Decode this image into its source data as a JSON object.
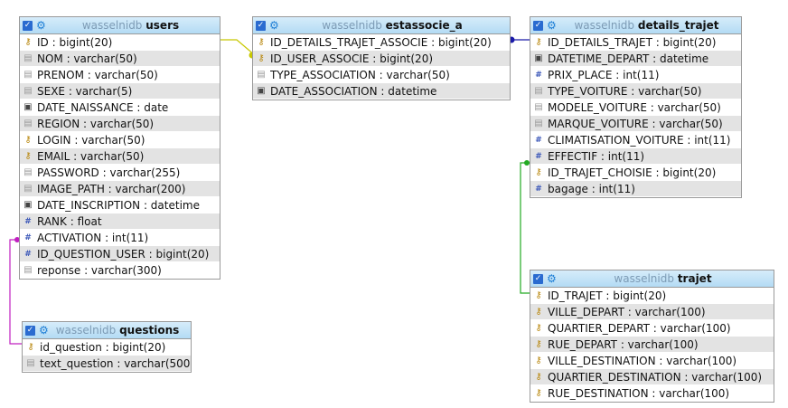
{
  "tables": [
    {
      "id": "users",
      "db": "wasselnidb",
      "name": "users",
      "rows": [
        {
          "text": "ID : bigint(20)",
          "icon": "key-icon"
        },
        {
          "text": "NOM : varchar(50)",
          "icon": "text-icon"
        },
        {
          "text": "PRENOM : varchar(50)",
          "icon": "text-icon"
        },
        {
          "text": "SEXE : varchar(5)",
          "icon": "text-icon"
        },
        {
          "text": "DATE_NAISSANCE : date",
          "icon": "date-icon"
        },
        {
          "text": "REGION : varchar(50)",
          "icon": "text-icon"
        },
        {
          "text": "LOGIN : varchar(50)",
          "icon": "key-icon"
        },
        {
          "text": "EMAIL : varchar(50)",
          "icon": "key-icon"
        },
        {
          "text": "PASSWORD : varchar(255)",
          "icon": "text-icon"
        },
        {
          "text": "IMAGE_PATH : varchar(200)",
          "icon": "text-icon"
        },
        {
          "text": "DATE_INSCRIPTION : datetime",
          "icon": "date-icon"
        },
        {
          "text": "RANK : float",
          "icon": "number-icon"
        },
        {
          "text": "ACTIVATION : int(11)",
          "icon": "number-icon"
        },
        {
          "text": "ID_QUESTION_USER : bigint(20)",
          "icon": "number-icon"
        },
        {
          "text": "reponse : varchar(300)",
          "icon": "text-icon"
        }
      ]
    },
    {
      "id": "questions",
      "db": "wasselnidb",
      "name": "questions",
      "rows": [
        {
          "text": "id_question : bigint(20)",
          "icon": "key-icon"
        },
        {
          "text": "text_question : varchar(500)",
          "icon": "text-icon"
        }
      ]
    },
    {
      "id": "estassocie_a",
      "db": "wasselnidb",
      "name": "estassocie_a",
      "rows": [
        {
          "text": "ID_DETAILS_TRAJET_ASSOCIE : bigint(20)",
          "icon": "key-icon"
        },
        {
          "text": "ID_USER_ASSOCIE : bigint(20)",
          "icon": "key-icon"
        },
        {
          "text": "TYPE_ASSOCIATION : varchar(50)",
          "icon": "text-icon"
        },
        {
          "text": "DATE_ASSOCIATION : datetime",
          "icon": "date-icon"
        }
      ]
    },
    {
      "id": "details_trajet",
      "db": "wasselnidb",
      "name": "details_trajet",
      "rows": [
        {
          "text": "ID_DETAILS_TRAJET : bigint(20)",
          "icon": "key-icon"
        },
        {
          "text": "DATETIME_DEPART : datetime",
          "icon": "date-icon"
        },
        {
          "text": "PRIX_PLACE : int(11)",
          "icon": "number-icon"
        },
        {
          "text": "TYPE_VOITURE : varchar(50)",
          "icon": "text-icon"
        },
        {
          "text": "MODELE_VOITURE : varchar(50)",
          "icon": "text-icon"
        },
        {
          "text": "MARQUE_VOITURE : varchar(50)",
          "icon": "text-icon"
        },
        {
          "text": "CLIMATISATION_VOITURE : int(11)",
          "icon": "number-icon"
        },
        {
          "text": "EFFECTIF : int(11)",
          "icon": "number-icon"
        },
        {
          "text": "ID_TRAJET_CHOISIE : bigint(20)",
          "icon": "key-icon"
        },
        {
          "text": "bagage : int(11)",
          "icon": "number-icon"
        }
      ]
    },
    {
      "id": "trajet",
      "db": "wasselnidb",
      "name": "trajet",
      "rows": [
        {
          "text": "ID_TRAJET : bigint(20)",
          "icon": "key-icon"
        },
        {
          "text": "VILLE_DEPART : varchar(100)",
          "icon": "key-icon"
        },
        {
          "text": "QUARTIER_DEPART : varchar(100)",
          "icon": "key-icon"
        },
        {
          "text": "RUE_DEPART : varchar(100)",
          "icon": "key-icon"
        },
        {
          "text": "VILLE_DESTINATION : varchar(100)",
          "icon": "key-icon"
        },
        {
          "text": "QUARTIER_DESTINATION : varchar(100)",
          "icon": "key-icon"
        },
        {
          "text": "RUE_DESTINATION : varchar(100)",
          "icon": "key-icon"
        }
      ]
    }
  ],
  "relations": [
    {
      "from": "estassocie_a.ID_USER_ASSOCIE",
      "to": "users.ID",
      "color": "#c8c800"
    },
    {
      "from": "estassocie_a.ID_DETAILS_TRAJET_ASSOCIE",
      "to": "details_trajet.ID_DETAILS_TRAJET",
      "color": "#1a1aa8"
    },
    {
      "from": "details_trajet.ID_TRAJET_CHOISIE",
      "to": "trajet.ID_TRAJET",
      "color": "#22aa22"
    },
    {
      "from": "users.ID_QUESTION_USER",
      "to": "questions.id_question",
      "color": "#c020c0"
    }
  ]
}
